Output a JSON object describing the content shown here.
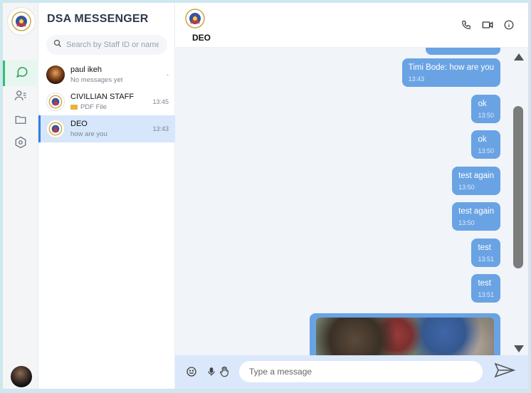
{
  "app": {
    "title": "DSA MESSENGER"
  },
  "search": {
    "placeholder": "Search by Staff ID or name"
  },
  "conversations": [
    {
      "name": "paul ikeh",
      "preview": "No messages yet",
      "time": "-"
    },
    {
      "name": "CIVILLIAN STAFF",
      "preview": "PDF File",
      "time": "13:45"
    },
    {
      "name": "DEO",
      "preview": "how are you",
      "time": "13:43"
    }
  ],
  "chat": {
    "contact_name": "DEO"
  },
  "messages": [
    {
      "text": "Timi Bode: how are you",
      "time": "13:43"
    },
    {
      "text": "ok",
      "time": "13:50"
    },
    {
      "text": "ok",
      "time": "13:50"
    },
    {
      "text": "test again",
      "time": "13:50"
    },
    {
      "text": "test again",
      "time": "13:50"
    },
    {
      "text": "test",
      "time": "13:51"
    },
    {
      "text": "test",
      "time": "13:51"
    }
  ],
  "composer": {
    "placeholder": "Type a message"
  },
  "colors": {
    "bubble": "#6aa3e4",
    "active_nav": "#2fbf71",
    "active_chat": "#d6e6fb",
    "composer_bg": "#dbe8fb"
  }
}
